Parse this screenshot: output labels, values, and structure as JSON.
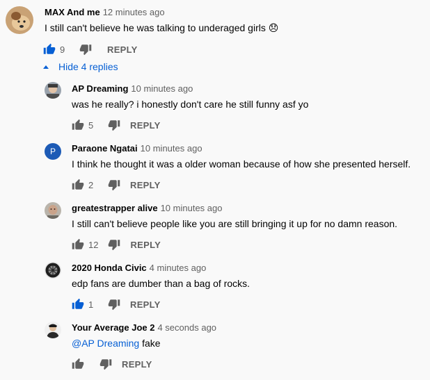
{
  "colors": {
    "link": "#065fd4",
    "like_active": "#065fd4",
    "icon": "#606060"
  },
  "comment": {
    "author": "MAX And me",
    "time": "12 minutes ago",
    "text": "I still can't believe he was talking to underaged girls 😞",
    "likes": "9",
    "liked": true,
    "reply_label": "REPLY"
  },
  "hide_replies_label": "Hide 4 replies",
  "replies": [
    {
      "author": "AP Dreaming",
      "time": "10 minutes ago",
      "text": "was he really? i honestly don't care he still funny asf yo",
      "likes": "5",
      "liked": false,
      "reply_label": "REPLY"
    },
    {
      "author": "Paraone Ngatai",
      "time": "10 minutes ago",
      "text": "I think he thought it was a older woman because of how she presented herself.",
      "likes": "2",
      "liked": false,
      "reply_label": "REPLY",
      "avatar_letter": "P"
    },
    {
      "author": "greatestrapper alive",
      "time": "10 minutes ago",
      "text": "I still can't believe people like you are still bringing it up for no damn reason.",
      "likes": "12",
      "liked": false,
      "reply_label": "REPLY"
    },
    {
      "author": "2020 Honda Civic",
      "time": "4 minutes ago",
      "text": "edp fans are dumber than a bag of rocks.",
      "likes": "1",
      "liked": true,
      "reply_label": "REPLY"
    },
    {
      "author": "Your Average Joe 2",
      "time": "4 seconds ago",
      "mention": "@AP Dreaming",
      "text": " fake",
      "likes": "",
      "liked": false,
      "reply_label": "REPLY"
    }
  ]
}
